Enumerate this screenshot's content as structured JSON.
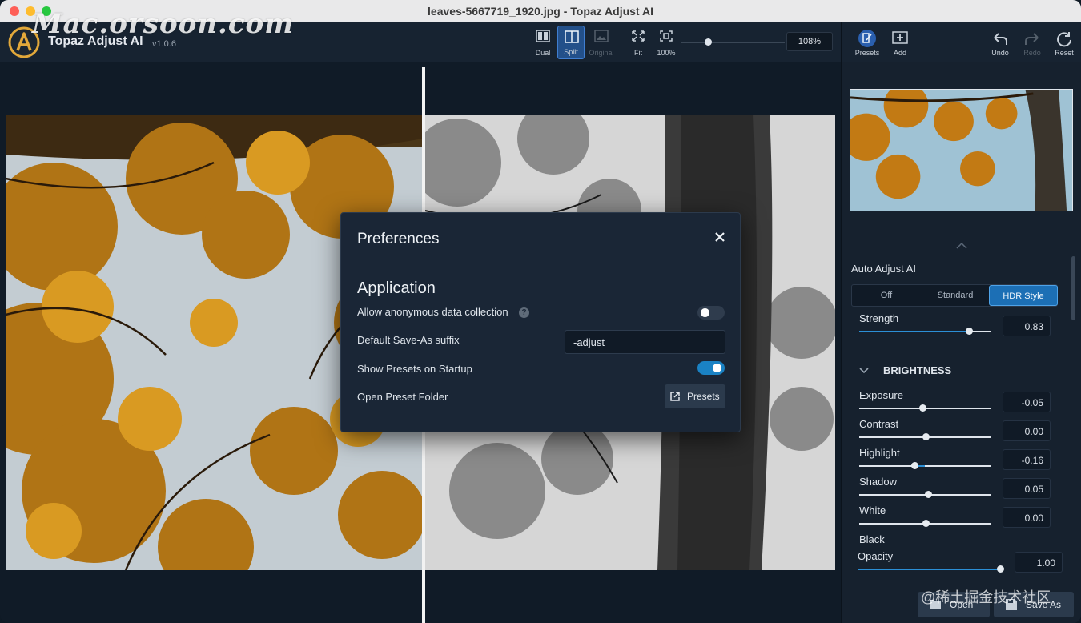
{
  "window": {
    "title": "leaves-5667719_1920.jpg - Topaz Adjust AI"
  },
  "watermark": "Mac.orsoon.com",
  "watermark2": "@稀土掘金技术社区",
  "app": {
    "name": "Topaz Adjust AI",
    "version": "v1.0.6"
  },
  "toolbar": {
    "dual": "Dual",
    "split": "Split",
    "original": "Original",
    "fit": "Fit",
    "zoom100": "100%",
    "zoom_value": "108%"
  },
  "right_toolbar": {
    "presets": "Presets",
    "add": "Add",
    "undo": "Undo",
    "redo": "Redo",
    "reset": "Reset"
  },
  "dialog": {
    "title": "Preferences",
    "section": "Application",
    "anon_label": "Allow anonymous data collection",
    "anon_on": false,
    "suffix_label": "Default Save-As suffix",
    "suffix_value": "-adjust",
    "startup_label": "Show Presets on Startup",
    "startup_on": true,
    "folder_label": "Open Preset Folder",
    "folder_button": "Presets"
  },
  "auto_adjust": {
    "title": "Auto Adjust AI",
    "modes": [
      "Off",
      "Standard",
      "HDR Style"
    ],
    "active_mode": "HDR Style",
    "strength_label": "Strength",
    "strength_value": "0.83",
    "strength_fraction": 0.83
  },
  "brightness": {
    "title": "BRIGHTNESS",
    "sliders": [
      {
        "label": "Exposure",
        "value": "-0.05",
        "pos": 0.48
      },
      {
        "label": "Contrast",
        "value": "0.00",
        "pos": 0.5
      },
      {
        "label": "Highlight",
        "value": "-0.16",
        "pos": 0.42
      },
      {
        "label": "Shadow",
        "value": "0.05",
        "pos": 0.52
      },
      {
        "label": "White",
        "value": "0.00",
        "pos": 0.5
      },
      {
        "label": "Black",
        "value": "",
        "pos": 0.5
      }
    ]
  },
  "opacity": {
    "label": "Opacity",
    "value": "1.00",
    "pos": 1.0
  },
  "bottom": {
    "open": "Open",
    "save_as": "Save As"
  },
  "colors": {
    "accent": "#1c6fb5",
    "panel": "#16212e",
    "dialog": "#1a2636"
  }
}
